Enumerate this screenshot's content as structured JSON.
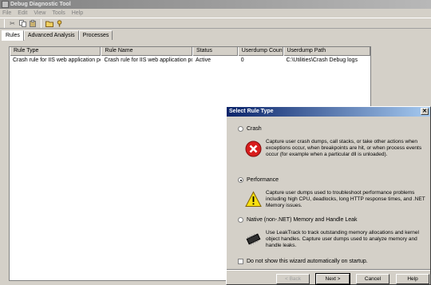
{
  "window": {
    "title": "Debug Diagnostic Tool"
  },
  "menu": [
    "File",
    "Edit",
    "View",
    "Tools",
    "Help"
  ],
  "toolbar": {
    "icons": [
      "cut-icon",
      "copy-icon",
      "paste-icon",
      "folder-icon",
      "help-icon"
    ]
  },
  "tabs": [
    {
      "label": "Rules",
      "active": true
    },
    {
      "label": "Advanced Analysis",
      "active": false
    },
    {
      "label": "Processes",
      "active": false
    }
  ],
  "rules_list": {
    "columns": [
      "Rule Type",
      "Rule Name",
      "Status",
      "Userdump Count",
      "Userdump Path"
    ],
    "rows": [
      [
        "Crash rule for IIS web application poo...",
        "Crash rule for IIS web application poo...",
        "Active",
        "0",
        "C:\\Utilities\\Crash Debug logs"
      ]
    ]
  },
  "dialog": {
    "title": "Select Rule Type",
    "options": [
      {
        "label": "Crash",
        "checked": false,
        "icon": "error-icon",
        "description": "Capture user crash dumps, call stacks, or take other actions when exceptions occur, when breakpoints are hit, or when process events occur (for example when a particular dll is unloaded)."
      },
      {
        "label": "Performance",
        "checked": true,
        "icon": "warning-icon",
        "description": "Capture user dumps used to troubleshoot performance problems including high CPU, deadlocks, long HTTP response times, and .NET Memory issues."
      },
      {
        "label": "Native (non-.NET) Memory and Handle Leak",
        "checked": false,
        "icon": "memory-chip-icon",
        "description": "Use LeakTrack to track outstanding memory allocations and kernel object handles. Capture user dumps used to analyze memory and handle leaks."
      }
    ],
    "checkbox_label": "Do not show this wizard automatically on startup.",
    "buttons": {
      "back": "< Back",
      "next": "Next >",
      "cancel": "Cancel",
      "help": "Help"
    }
  }
}
